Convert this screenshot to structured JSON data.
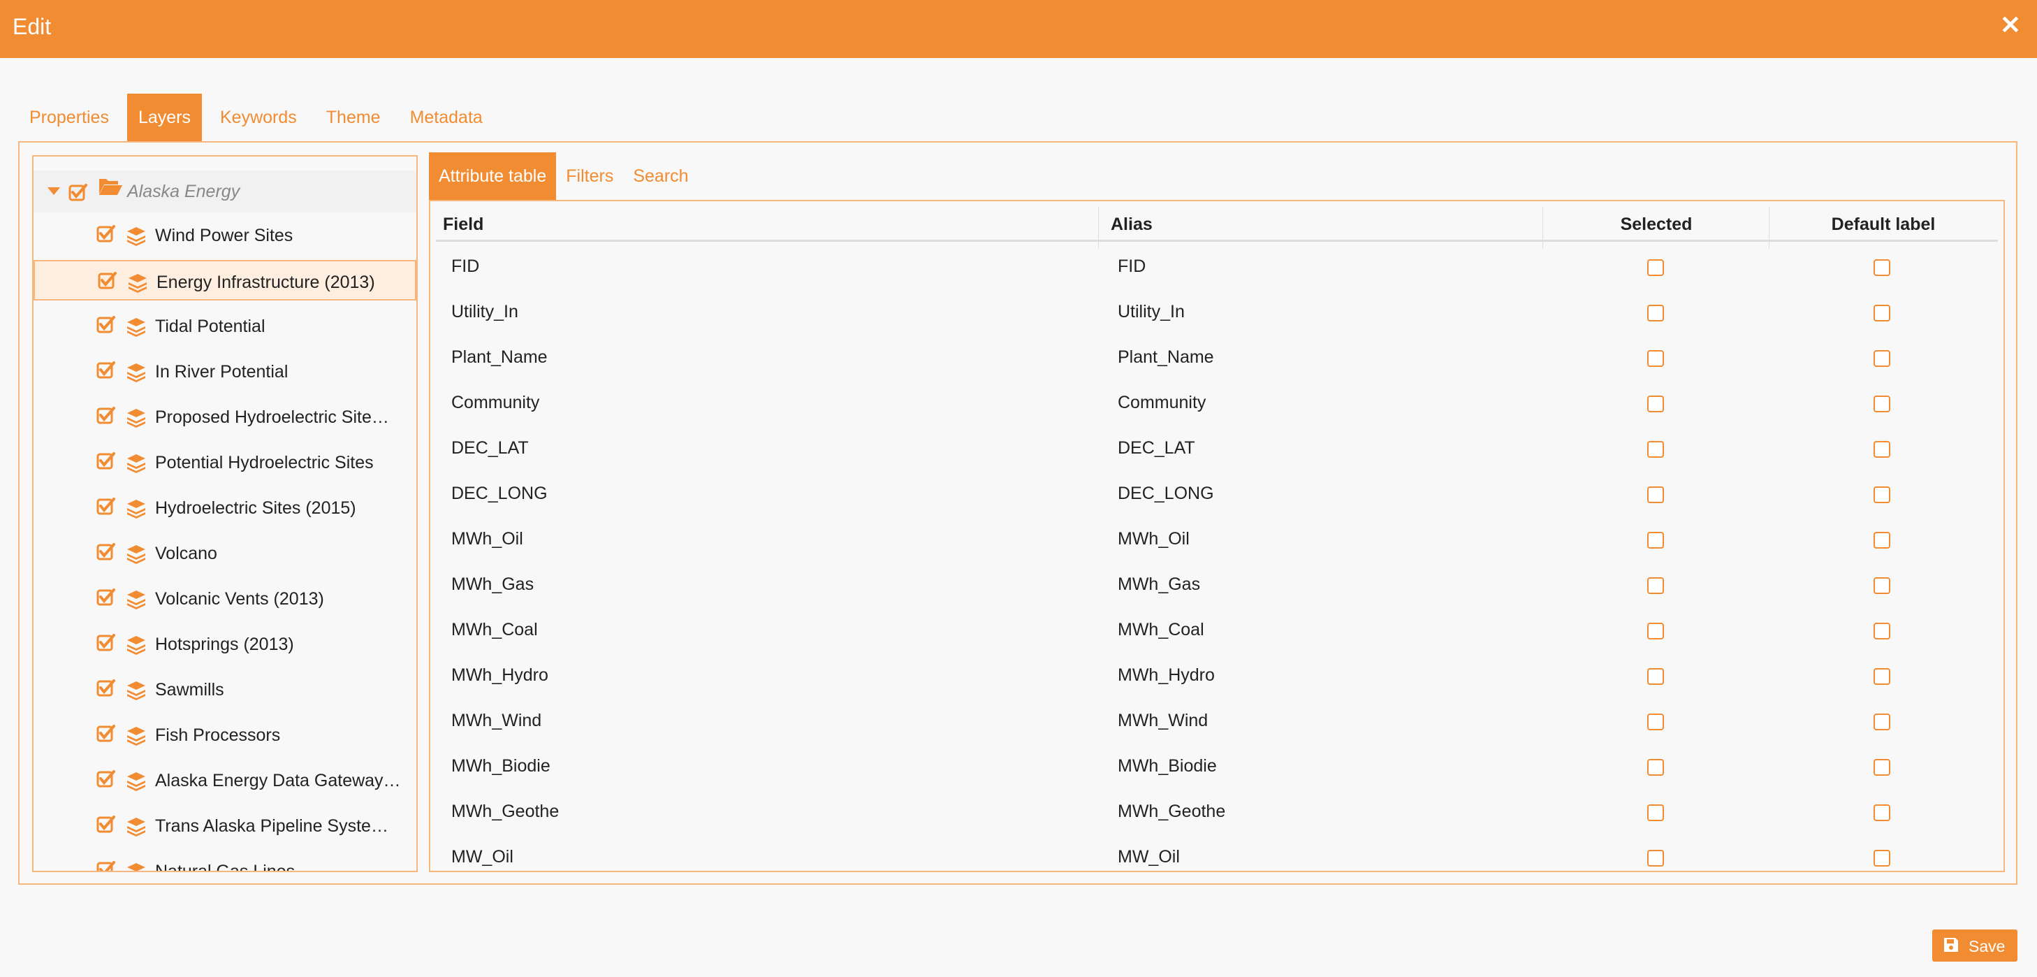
{
  "window": {
    "title": "Edit",
    "close_glyph": "✕"
  },
  "tabs": [
    {
      "label": "Properties",
      "active": false
    },
    {
      "label": "Layers",
      "active": true
    },
    {
      "label": "Keywords",
      "active": false
    },
    {
      "label": "Theme",
      "active": false
    },
    {
      "label": "Metadata",
      "active": false
    }
  ],
  "tree": {
    "root": {
      "label": "Alaska Energy",
      "checked": true,
      "expanded": true,
      "icon": "folder-open-icon"
    },
    "items": [
      {
        "label": "Wind Power Sites",
        "checked": true,
        "selected": false,
        "icon": "layers-icon"
      },
      {
        "label": "Energy Infrastructure (2013)",
        "checked": true,
        "selected": true,
        "icon": "layers-icon"
      },
      {
        "label": "Tidal Potential",
        "checked": true,
        "selected": false,
        "icon": "layers-icon"
      },
      {
        "label": "In River Potential",
        "checked": true,
        "selected": false,
        "icon": "layers-icon"
      },
      {
        "label": "Proposed Hydroelectric Site…",
        "checked": true,
        "selected": false,
        "icon": "layers-icon"
      },
      {
        "label": "Potential Hydroelectric Sites",
        "checked": true,
        "selected": false,
        "icon": "layers-icon"
      },
      {
        "label": "Hydroelectric Sites (2015)",
        "checked": true,
        "selected": false,
        "icon": "layers-icon"
      },
      {
        "label": "Volcano",
        "checked": true,
        "selected": false,
        "icon": "layers-icon"
      },
      {
        "label": "Volcanic Vents (2013)",
        "checked": true,
        "selected": false,
        "icon": "layers-icon"
      },
      {
        "label": "Hotsprings (2013)",
        "checked": true,
        "selected": false,
        "icon": "layers-icon"
      },
      {
        "label": "Sawmills",
        "checked": true,
        "selected": false,
        "icon": "layers-icon"
      },
      {
        "label": "Fish Processors",
        "checked": true,
        "selected": false,
        "icon": "layers-icon"
      },
      {
        "label": "Alaska Energy Data Gateway…",
        "checked": true,
        "selected": false,
        "icon": "layers-icon"
      },
      {
        "label": "Trans Alaska Pipeline Syste…",
        "checked": true,
        "selected": false,
        "icon": "layers-icon"
      },
      {
        "label": "Natural Gas Lines",
        "checked": true,
        "selected": false,
        "icon": "layers-icon"
      }
    ]
  },
  "subtabs": [
    {
      "label": "Attribute table",
      "active": true
    },
    {
      "label": "Filters",
      "active": false
    },
    {
      "label": "Search",
      "active": false
    }
  ],
  "table": {
    "headers": {
      "field": "Field",
      "alias": "Alias",
      "selected": "Selected",
      "default_label": "Default label"
    },
    "rows": [
      {
        "field": "FID",
        "alias": "FID",
        "selected": false,
        "default_label": false
      },
      {
        "field": "Utility_In",
        "alias": "Utility_In",
        "selected": false,
        "default_label": false
      },
      {
        "field": "Plant_Name",
        "alias": "Plant_Name",
        "selected": false,
        "default_label": false
      },
      {
        "field": "Community",
        "alias": "Community",
        "selected": false,
        "default_label": false
      },
      {
        "field": "DEC_LAT",
        "alias": "DEC_LAT",
        "selected": false,
        "default_label": false
      },
      {
        "field": "DEC_LONG",
        "alias": "DEC_LONG",
        "selected": false,
        "default_label": false
      },
      {
        "field": "MWh_Oil",
        "alias": "MWh_Oil",
        "selected": false,
        "default_label": false
      },
      {
        "field": "MWh_Gas",
        "alias": "MWh_Gas",
        "selected": false,
        "default_label": false
      },
      {
        "field": "MWh_Coal",
        "alias": "MWh_Coal",
        "selected": false,
        "default_label": false
      },
      {
        "field": "MWh_Hydro",
        "alias": "MWh_Hydro",
        "selected": false,
        "default_label": false
      },
      {
        "field": "MWh_Wind",
        "alias": "MWh_Wind",
        "selected": false,
        "default_label": false
      },
      {
        "field": "MWh_Biodie",
        "alias": "MWh_Biodie",
        "selected": false,
        "default_label": false
      },
      {
        "field": "MWh_Geothe",
        "alias": "MWh_Geothe",
        "selected": false,
        "default_label": false
      },
      {
        "field": "MW_Oil",
        "alias": "MW_Oil",
        "selected": false,
        "default_label": false
      }
    ]
  },
  "footer": {
    "save_label": "Save",
    "save_icon": "floppy-disk-icon"
  },
  "colors": {
    "accent": "#f28c32",
    "border": "#f7b67e",
    "background": "#f8f8f8",
    "selected_row": "#fdeee0"
  }
}
